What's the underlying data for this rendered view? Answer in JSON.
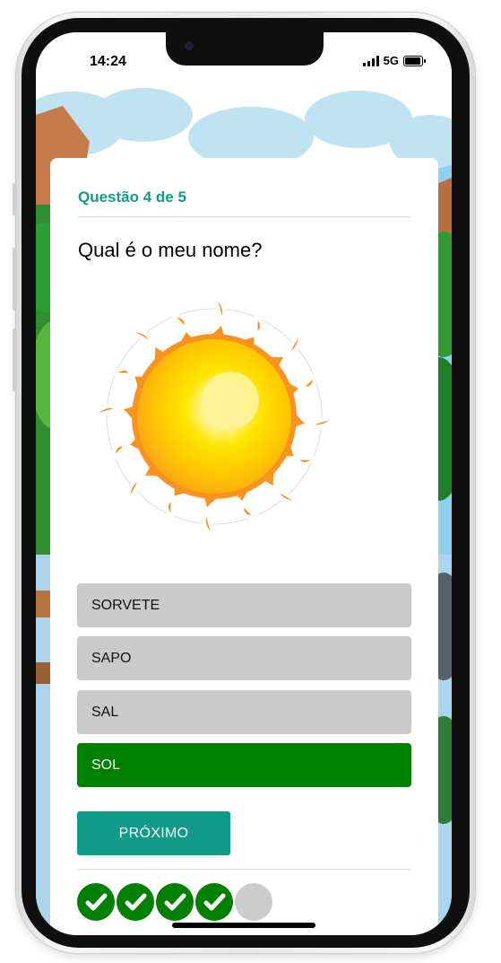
{
  "status_bar": {
    "time": "14:24",
    "network": "5G"
  },
  "quiz": {
    "progress_text": "Questão 4 de 5",
    "question": "Qual é o meu nome?",
    "image": "sun-illustration",
    "options": [
      {
        "label": "SORVETE",
        "selected": false
      },
      {
        "label": "SAPO",
        "selected": false
      },
      {
        "label": "SAL",
        "selected": false
      },
      {
        "label": "SOL",
        "selected": true
      }
    ],
    "next_label": "PRÓXIMO",
    "progress": [
      {
        "state": "correct"
      },
      {
        "state": "correct"
      },
      {
        "state": "correct"
      },
      {
        "state": "correct"
      },
      {
        "state": "pending"
      }
    ]
  },
  "colors": {
    "accent": "#0f9a8a",
    "selected": "#008000",
    "option_bg": "#cacaca",
    "pending": "#cccccc"
  },
  "icons": [
    "signal-icon",
    "battery-icon",
    "check-icon",
    "sun-icon"
  ]
}
